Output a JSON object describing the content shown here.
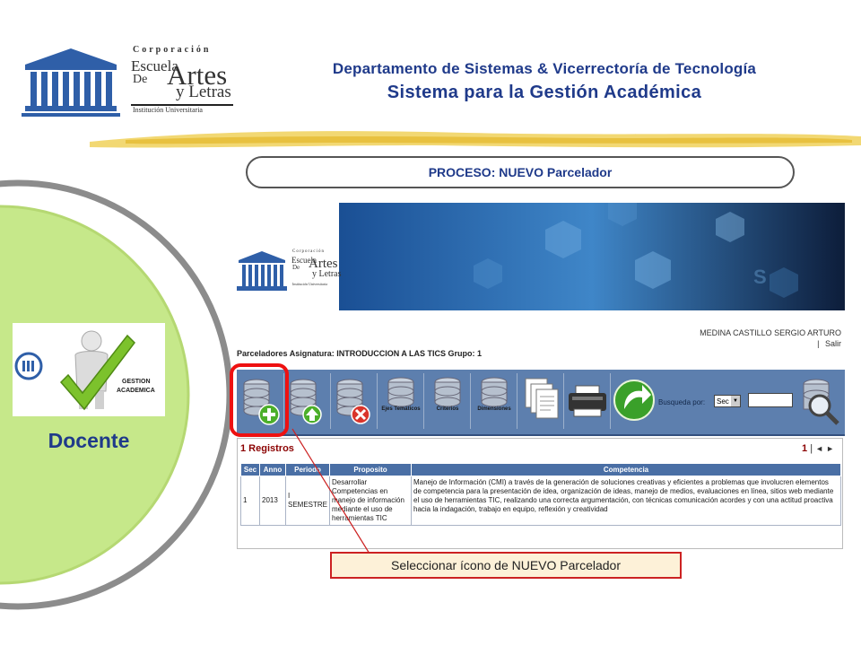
{
  "header": {
    "logo": {
      "line1": "Corporación",
      "line2": "Escuela",
      "line3": "De",
      "line4": "Artes",
      "line5": "y Letras",
      "line6": "Institución Universitaria"
    },
    "department": "Departamento de Sistemas & Vicerrectoría de Tecnología",
    "system_name": "Sistema para la Gestión Académica"
  },
  "left_panel": {
    "badge_text_line1": "GESTION",
    "badge_text_line2": "ACADEMICA",
    "role": "Docente"
  },
  "process": {
    "label": "PROCESO:  NUEVO Parcelador"
  },
  "app": {
    "banner_logo": {
      "line1": "Corporación",
      "line2": "Escuela",
      "line3": "De",
      "line4": "Artes",
      "line5": "y Letras",
      "line6": "Institución Universitaria"
    },
    "banner_letter": "S",
    "user_name": "MEDINA CASTILLO SERGIO ARTURO",
    "logout_separator": "|",
    "logout": "Salir",
    "title": "Parceladores Asignatura: INTRODUCCION A LAS TICS Grupo: 1",
    "toolbar": {
      "ejes_label": "Ejes Temáticos",
      "criterios_label": "Criterios",
      "dimensiones_label": "Dimensiones",
      "search_label": "Busqueda por:",
      "search_select_value": "Sec",
      "select_arrow": "▼"
    },
    "records_label": "1 Registros",
    "pager": {
      "page": "1",
      "separator": "|",
      "prev": "◄",
      "next": "►"
    },
    "table": {
      "columns": [
        "Sec",
        "Anno",
        "Periodo",
        "Proposito",
        "Competencia"
      ],
      "rows": [
        {
          "sec": "1",
          "anno": "2013",
          "periodo": "I SEMESTRE",
          "proposito": "Desarrollar Competencias en manejo de información mediante el uso de herramientas TIC",
          "competencia": "Manejo de Información (CMI) a través de la generación de soluciones creativas y eficientes a problemas que involucren elementos de competencia para la presentación de idea, organización de ideas, manejo de medios, evaluaciones en línea, sitios web mediante el uso de herramientas TIC, realizando una correcta argumentación, con técnicas comunicación acordes y con una actitud proactiva hacia la indagación, trabajo en equipo, reflexión y creatividad"
        }
      ]
    }
  },
  "callout": {
    "text": "Seleccionar ícono de NUEVO Parcelador"
  },
  "colors": {
    "title_blue": "#1f3a8a",
    "highlight_red": "#e11111",
    "toolbar_blue": "#5d7fae",
    "panel_green": "#c6e88a"
  }
}
